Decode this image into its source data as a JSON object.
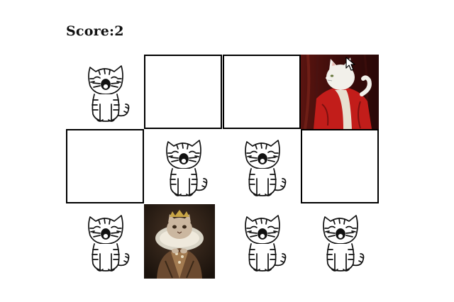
{
  "score_text": "Score:2",
  "board": {
    "rows": 3,
    "cols": 4,
    "cells": [
      {
        "state": "matched",
        "icon": "kitten-icon"
      },
      {
        "state": "hidden"
      },
      {
        "state": "hidden"
      },
      {
        "state": "revealed",
        "icon": "red-coat-cat-portrait-icon"
      },
      {
        "state": "hidden"
      },
      {
        "state": "matched",
        "icon": "kitten-icon"
      },
      {
        "state": "matched",
        "icon": "kitten-icon"
      },
      {
        "state": "hidden"
      },
      {
        "state": "matched",
        "icon": "kitten-icon"
      },
      {
        "state": "revealed",
        "icon": "queen-cat-portrait-icon"
      },
      {
        "state": "matched",
        "icon": "kitten-icon"
      },
      {
        "state": "matched",
        "icon": "kitten-icon"
      }
    ]
  },
  "colors": {
    "tile_border": "#000000",
    "background": "#ffffff",
    "coat_red": "#c21d1a"
  }
}
